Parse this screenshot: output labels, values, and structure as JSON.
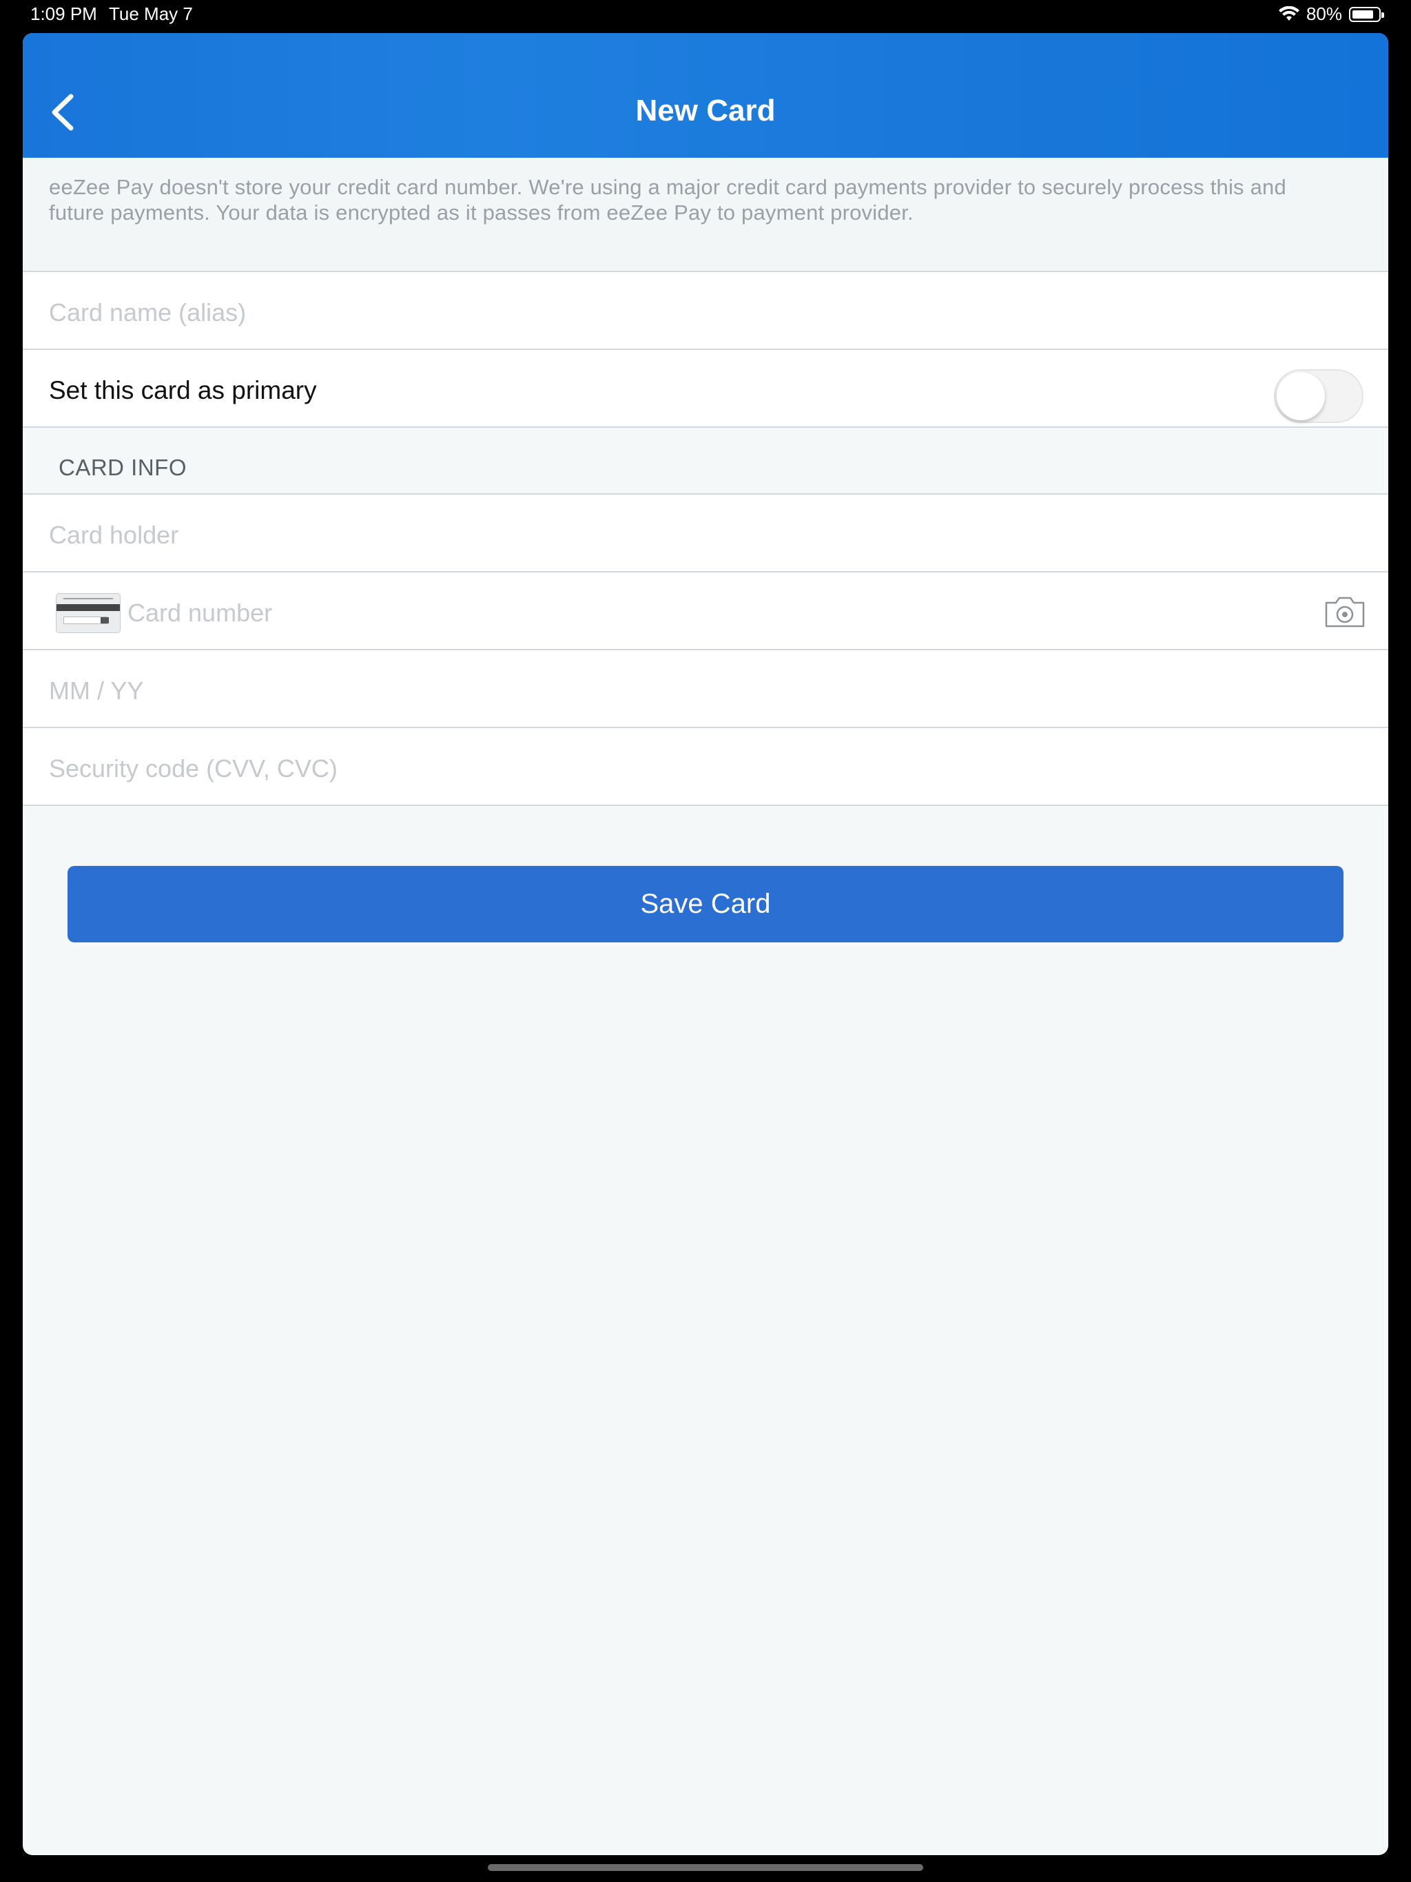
{
  "status_bar": {
    "time": "1:09 PM",
    "date": "Tue May 7",
    "battery": "80%",
    "battery_level": 0.8
  },
  "nav": {
    "title": "New Card"
  },
  "notice": {
    "text": "eeZee Pay doesn't store your credit card number. We're using a major credit card payments provider to securely process this and future payments. Your data is encrypted as it passes from eeZee Pay to payment provider."
  },
  "form": {
    "alias_placeholder": "Card name (alias)",
    "primary_label": "Set this card as primary",
    "primary_on": false,
    "section_title": "CARD INFO",
    "holder_placeholder": "Card holder",
    "number_placeholder": "Card number",
    "expiry_placeholder": "MM / YY",
    "cvv_placeholder": "Security code (CVV, CVC)"
  },
  "actions": {
    "save_label": "Save Card"
  },
  "colors": {
    "navbar": "#1a78da",
    "button": "#2b6fd2",
    "background": "#f4f8f9"
  }
}
